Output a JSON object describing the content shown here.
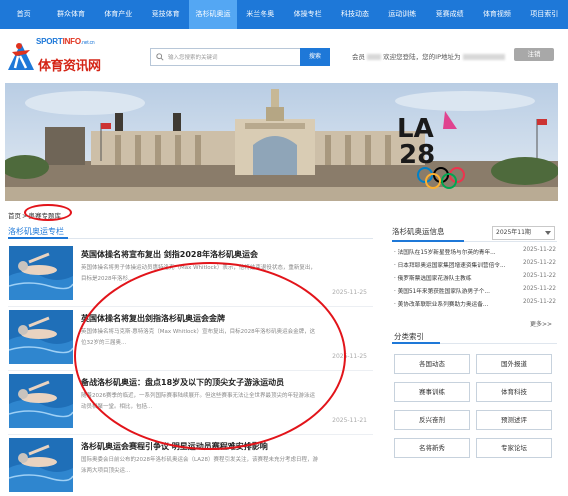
{
  "nav": {
    "items": [
      "首页",
      "群众体育",
      "体育产业",
      "竞技体育",
      "洛杉矶奥运",
      "米兰冬奥",
      "体操专栏",
      "科技动态",
      "运动训练",
      "竞赛成绩",
      "体育视频",
      "项目索引"
    ],
    "active_index": 4,
    "color": "#1e78d8",
    "active_color": "#54a7f3"
  },
  "logo": {
    "sport_text": "SPORT",
    "info_text": "INFO",
    "domain_text": ".net.cn",
    "cn_text": "体育资讯网"
  },
  "search": {
    "placeholder": "输入您搜索的关键词",
    "button_label": "搜索"
  },
  "member": {
    "prefix": "会员",
    "welcome": "欢迎您登陆，您的IP地址为",
    "logout_label": "注销"
  },
  "banner": {
    "la_text": "LA",
    "year_text": "28"
  },
  "breadcrumb": {
    "home": "首页",
    "separator": ">",
    "current": "奥赛专题库"
  },
  "left_section": {
    "title": "洛杉矶奥运专栏",
    "articles": [
      {
        "title": "英国体操名将宣布复出 剑指2028年洛杉矶奥运会",
        "summary": "英国体操名将男子体操运动员惠特洛克（Max Whitlock）表示，他将结束退役状态，重新复出，目标是2028年洛杉...",
        "date": "2025-11-25"
      },
      {
        "title": "英国体操名将复出剑指洛杉矶奥运会金牌",
        "summary": "英国体操名将马克斯·惠特洛克（Max Whitlock）宣布复出，目标2028年洛杉矶奥运会金牌，这位32岁的三届奥...",
        "date": "2025-11-25"
      },
      {
        "title": "备战洛杉矶奥运：盘点18岁及以下的顶尖女子游泳运动员",
        "summary": "随着2026赛季的临近，一系列国际赛事陆续展开。但这些赛事无法让全世界最顶尖的年轻游泳运动员相聚一堂。相比，包括...",
        "date": "2025-11-21"
      },
      {
        "title": "洛杉矶奥运会赛程引争议 明星运动员赛程难安排影响",
        "summary": "国际奥委会日前公布的2028年洛杉矶奥运会（LA28）赛程引发关注，该赛程未充分考虑日程，游泳两大项目顶尖运...",
        "date": ""
      }
    ]
  },
  "right_news": {
    "title": "洛杉矶奥运信息",
    "select_value": "2025年11期",
    "items": [
      {
        "text": "· 法国队在15岁新星登场与尔英的青年...",
        "date": "2025-11-22"
      },
      {
        "text": "· 日本拜耶奥运国家集团增速资集训营倍令...",
        "date": "2025-11-22"
      },
      {
        "text": "· 俄罗斯票选国家花游队主教练",
        "date": "2025-11-22"
      },
      {
        "text": "· 美国51年来第获胜国家队游男子个...",
        "date": "2025-11-22"
      },
      {
        "text": "· 美协改革联职业系列赛助力奥运备...",
        "date": "2025-11-22"
      }
    ],
    "more_label": "更多>>"
  },
  "categories": {
    "title": "分类索引",
    "items": [
      "各国动态",
      "国外报道",
      "赛事训练",
      "体育科技",
      "反兴奋剂",
      "预测述评",
      "名将新秀",
      "专家论坛"
    ]
  }
}
